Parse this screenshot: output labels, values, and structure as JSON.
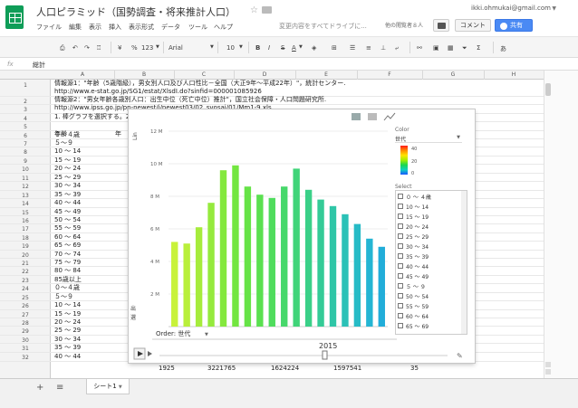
{
  "header": {
    "title": "人口ピラミッド（国勢調査・将来推計人口）",
    "save_status": "変更内容をすべてドライブに...",
    "viewers": "他の閲覧者８人",
    "account": "ikki.ohmukai@gmail.com",
    "comment_label": "コメント",
    "share_label": "共有"
  },
  "menu": [
    "ファイル",
    "編集",
    "表示",
    "挿入",
    "表示形式",
    "データ",
    "ツール",
    "ヘルプ"
  ],
  "toolbar": {
    "currency": "¥",
    "percent": "%",
    "number_format": "123",
    "font": "Arial",
    "font_size": "10",
    "bold": "B",
    "italic": "I",
    "strike": "S",
    "text_color": "A",
    "sigma": "Σ",
    "input_tools": "あ"
  },
  "formula": {
    "fx": "fx",
    "value": "総計"
  },
  "columns": [
    "A",
    "B",
    "C",
    "D",
    "E",
    "F",
    "G",
    "H"
  ],
  "rows": [
    "1",
    "2",
    "3",
    "4",
    "5",
    "6",
    "7",
    "8",
    "9",
    "10",
    "11",
    "12",
    "13",
    "14",
    "15",
    "16",
    "17",
    "18",
    "19",
    "20",
    "21",
    "22",
    "23",
    "24",
    "25",
    "26",
    "27",
    "28",
    "29",
    "30",
    "31",
    "32"
  ],
  "cells": {
    "r1": "情報源1：\"年齢（5歳階級），男女別人口及び人口性比－全国（大正9年～平成22年）\"，統計センター.",
    "r1b": "http://www.e-stat.go.jp/SG1/estat/XlsdI.do?sinfid=000001085926",
    "r2": "情報源2：\"男女年齢各歳別人口：出生中位（死亡中位）推計\"，国立社会保障・人口問題研究所.",
    "r2b": "http://www.ipss.go.jp/pp-newest/j/newest03/02_svosai/01/Mm1-9.xls",
    "r3": "1. 棒グラフを選択する。2",
    "age_header": "年齢",
    "year_header": "年",
    "ages": [
      "０～４歳",
      "５～９",
      "10 ～ 14",
      "15 ～ 19",
      "20 ～ 24",
      "25 ～ 29",
      "30 ～ 34",
      "35 ～ 39",
      "40 ～ 44",
      "45 ～ 49",
      "50 ～ 54",
      "55 ～ 59",
      "60 ～ 64",
      "65 ～ 69",
      "70 ～ 74",
      "75 ～ 79",
      "80 ～ 84",
      "85歳以上",
      "０～４歳",
      "５～９",
      "10 ～ 14",
      "15 ～ 19",
      "20 ～ 24",
      "25 ～ 29",
      "30 ～ 34",
      "35 ～ 39",
      "40 ～ 44"
    ],
    "row32": {
      "year": "1925",
      "total": "3221765",
      "male": "1624224",
      "female": "1597541",
      "ratio": "35"
    }
  },
  "chart": {
    "y_axis_label": "Lin",
    "order_label": "Order: 世代",
    "year_label": "2015",
    "color_title": "Color",
    "color_select": "世代",
    "color_ticks": [
      "40",
      "20",
      "0"
    ],
    "select_title": "Select",
    "select_items": [
      "０ ～ ４歳",
      "10 ～ 14",
      "15 ～ 19",
      "20 ～ 24",
      "25 ～ 29",
      "30 ～ 34",
      "35 ～ 39",
      "40 ～ 44",
      "45 ～ 49",
      "５ ～ ９",
      "50 ～ 54",
      "55 ～ 59",
      "60 ～ 64",
      "65 ～ 69"
    ],
    "side_labels": [
      "出",
      "選"
    ]
  },
  "chart_data": {
    "type": "bar",
    "y_ticks": [
      "12 M",
      "10 M",
      "8 M",
      "6 M",
      "4 M",
      "2 M"
    ],
    "ylim": [
      0,
      12
    ],
    "values": [
      5.2,
      5.1,
      6.1,
      7.6,
      9.6,
      9.9,
      8.6,
      8.1,
      7.9,
      8.6,
      9.7,
      8.4,
      7.8,
      7.4,
      6.9,
      6.3,
      5.4,
      4.9
    ],
    "colors": [
      "#c8f23a",
      "#b9ef3b",
      "#a6ec3c",
      "#95ea3d",
      "#84e83e",
      "#73e640",
      "#66e347",
      "#5ae050",
      "#4fdc5d",
      "#47d86b",
      "#40d479",
      "#3ad088",
      "#34cb97",
      "#2fc6a7",
      "#2bc1b7",
      "#27bbc6",
      "#24b5d3",
      "#21add9"
    ],
    "colorbar": [
      "#ff1a1a",
      "#ff8a00",
      "#ffe400",
      "#a6ee00",
      "#1ad64f",
      "#0fd0c0",
      "#1a55ff"
    ]
  },
  "bottom": {
    "sheet_name": "シート1",
    "add": "+",
    "list": "≡"
  }
}
